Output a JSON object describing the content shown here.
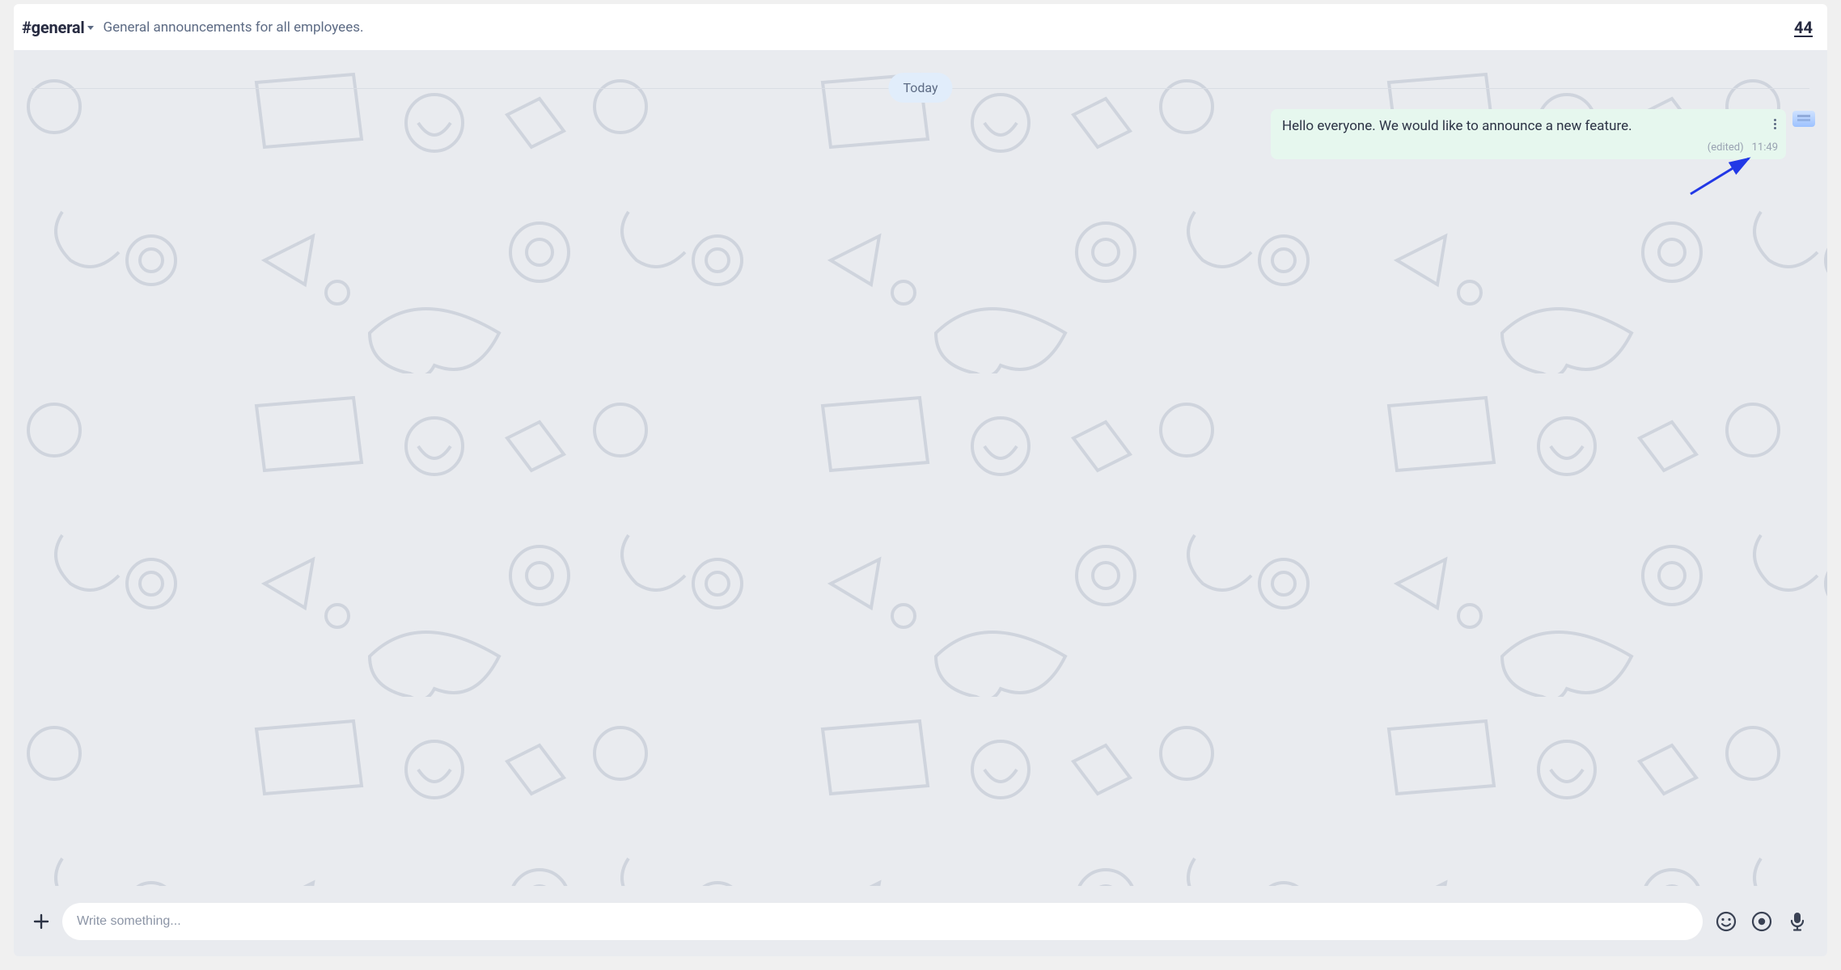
{
  "header": {
    "channel_name": "#general",
    "topic": "General announcements for all employees.",
    "member_count": "44"
  },
  "thread": {
    "date_label": "Today",
    "messages": [
      {
        "text": "Hello everyone. We would like to announce a new feature.",
        "edited_label": "(edited)",
        "timestamp": "11:49"
      }
    ]
  },
  "composer": {
    "placeholder": "Write something..."
  }
}
